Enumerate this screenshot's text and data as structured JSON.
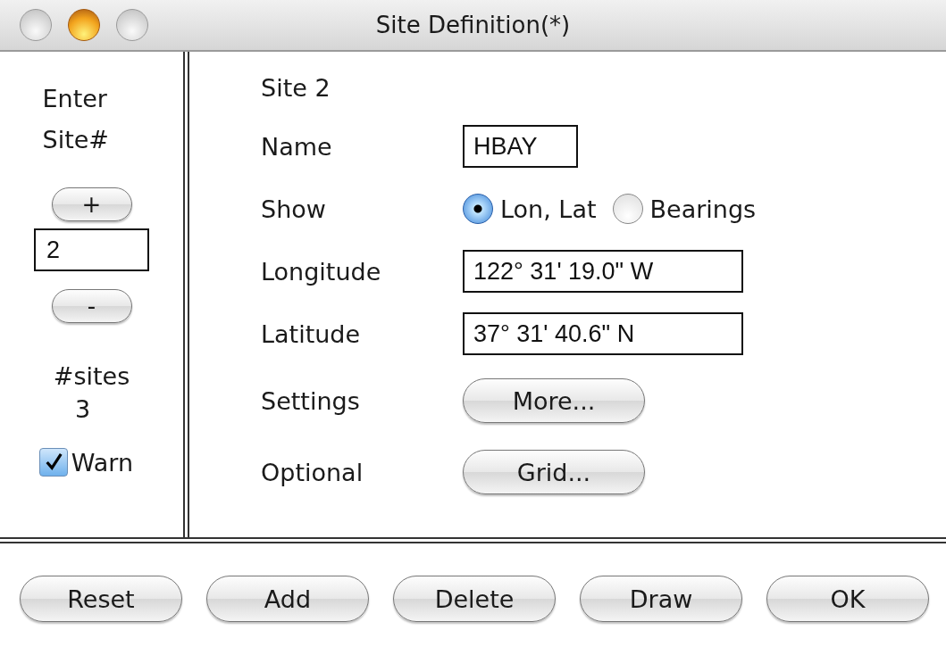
{
  "window": {
    "title": "Site Definition(*)"
  },
  "left": {
    "prompt": "Enter Site#",
    "increment": "+",
    "site_number": "2",
    "decrement": "-",
    "count_label": "#sites",
    "count": "3",
    "warn": {
      "label": "Warn",
      "checked": true
    }
  },
  "right": {
    "heading": "Site 2",
    "rows": [
      {
        "kind": "field",
        "label": "Name",
        "value": "HBAY",
        "wide": false
      },
      {
        "kind": "radio",
        "label": "Show",
        "options": [
          {
            "label": "Lon, Lat",
            "selected": true
          },
          {
            "label": "Bearings",
            "selected": false
          }
        ]
      },
      {
        "kind": "field",
        "label": "Longitude",
        "value": "122° 31' 19.0\" W",
        "wide": true
      },
      {
        "kind": "field",
        "label": "Latitude",
        "value": "37° 31' 40.6\" N",
        "wide": true
      },
      {
        "kind": "button",
        "label": "Settings",
        "button": "More..."
      },
      {
        "kind": "button",
        "label": "Optional",
        "button": "Grid..."
      }
    ]
  },
  "buttons": [
    "Reset",
    "Add",
    "Delete",
    "Draw",
    "OK"
  ]
}
